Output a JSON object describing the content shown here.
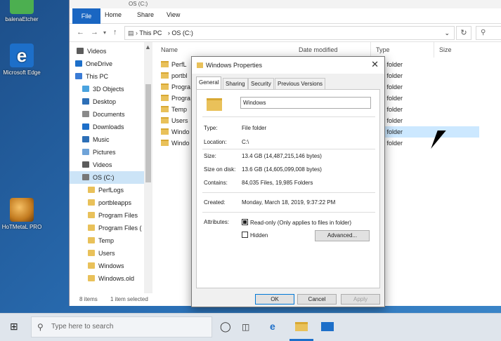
{
  "desktop": {
    "icons": [
      {
        "label": "balenaEtcher"
      },
      {
        "label": "Microsoft Edge"
      },
      {
        "label": "HoTMetaL PRO"
      }
    ]
  },
  "explorer": {
    "title": "OS (C:)",
    "ribbon_tabs": [
      "File",
      "Home",
      "Share",
      "View"
    ],
    "address": {
      "crumbs": [
        "This PC",
        "OS (C:)"
      ]
    },
    "nav_items": [
      {
        "label": "Videos",
        "icon": "videos-icon",
        "color": "#5c5c5c"
      },
      {
        "label": "OneDrive",
        "icon": "cloud-icon",
        "color": "#1d6fc9"
      },
      {
        "label": "This PC",
        "icon": "computer-icon",
        "color": "#3a7bd5"
      },
      {
        "label": "3D Objects",
        "icon": "cube-icon",
        "color": "#4aa3df"
      },
      {
        "label": "Desktop",
        "icon": "desktop-icon",
        "color": "#2d6fb7"
      },
      {
        "label": "Documents",
        "icon": "documents-icon",
        "color": "#8a8a8a"
      },
      {
        "label": "Downloads",
        "icon": "download-icon",
        "color": "#1d6fc9"
      },
      {
        "label": "Music",
        "icon": "music-icon",
        "color": "#2d6fb7"
      },
      {
        "label": "Pictures",
        "icon": "pictures-icon",
        "color": "#6fa3d8"
      },
      {
        "label": "Videos",
        "icon": "videos-icon",
        "color": "#5c5c5c"
      },
      {
        "label": "OS (C:)",
        "icon": "drive-icon",
        "color": "#777777"
      },
      {
        "label": "PerfLogs",
        "icon": "folder-icon",
        "color": "#e9c15a"
      },
      {
        "label": "portbleapps",
        "icon": "folder-icon",
        "color": "#e9c15a"
      },
      {
        "label": "Program Files",
        "icon": "folder-icon",
        "color": "#e9c15a"
      },
      {
        "label": "Program Files (",
        "icon": "folder-icon",
        "color": "#e9c15a"
      },
      {
        "label": "Temp",
        "icon": "folder-icon",
        "color": "#e9c15a"
      },
      {
        "label": "Users",
        "icon": "folder-icon",
        "color": "#e9c15a"
      },
      {
        "label": "Windows",
        "icon": "folder-icon",
        "color": "#e9c15a"
      },
      {
        "label": "Windows.old",
        "icon": "folder-icon",
        "color": "#e9c15a"
      }
    ],
    "columns": [
      "Name",
      "Date modified",
      "Type",
      "Size"
    ],
    "files": [
      {
        "name": "PerfL",
        "type": "e folder"
      },
      {
        "name": "portbl",
        "type": "e folder"
      },
      {
        "name": "Progra",
        "type": "e folder"
      },
      {
        "name": "Progra",
        "type": "e folder"
      },
      {
        "name": "Temp",
        "type": "e folder"
      },
      {
        "name": "Users",
        "type": "e folder"
      },
      {
        "name": "Windo",
        "type": "e folder"
      },
      {
        "name": "Windo",
        "type": "e folder"
      }
    ],
    "status": {
      "count": "8 items",
      "selection": "1 item selected"
    }
  },
  "properties": {
    "title": "Windows Properties",
    "tabs": [
      "General",
      "Sharing",
      "Security",
      "Previous Versions"
    ],
    "name": "Windows",
    "type_label": "Type:",
    "type_value": "File folder",
    "location_label": "Location:",
    "location_value": "C:\\",
    "size_label": "Size:",
    "size_value": "13.4 GB (14,487,215,146 bytes)",
    "size_on_disk_label": "Size on disk:",
    "size_on_disk_value": "13.6 GB (14,605,099,008 bytes)",
    "contains_label": "Contains:",
    "contains_value": "84,035 Files, 19,985 Folders",
    "created_label": "Created:",
    "created_value": "Monday, March 18, 2019, 9:37:22 PM",
    "attributes_label": "Attributes:",
    "readonly_label": "Read-only (Only applies to files in folder)",
    "readonly_state": "indeterminate",
    "hidden_label": "Hidden",
    "advanced_label": "Advanced...",
    "ok_label": "OK",
    "cancel_label": "Cancel",
    "apply_label": "Apply"
  },
  "taskbar": {
    "search_placeholder": "Type here to search"
  }
}
